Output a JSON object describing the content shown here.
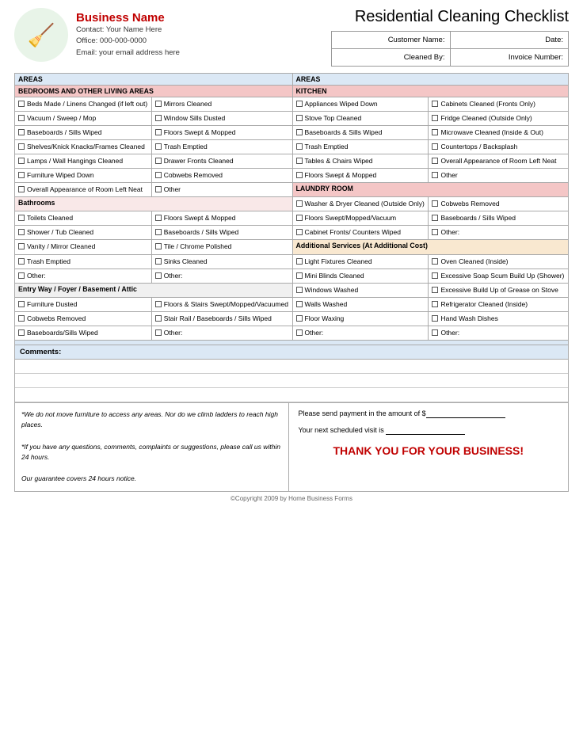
{
  "header": {
    "title": "Residential Cleaning Checklist",
    "business_name": "Business Name",
    "contact_label": "Contact:",
    "contact_value": "Your Name Here",
    "office_label": "Office:",
    "office_value": "000-000-0000",
    "email_label": "Email:",
    "email_value": "your email address here",
    "customer_name_label": "Customer Name:",
    "date_label": "Date:",
    "cleaned_by_label": "Cleaned By:",
    "invoice_label": "Invoice Number:"
  },
  "areas_label_left": "AREAS",
  "areas_label_right": "AREAS",
  "bedrooms_header": "BEDROOMS AND OTHER LIVING AREAS",
  "kitchen_header": "KITCHEN",
  "bedrooms_items_col1": [
    "Beds Made / Linens Changed (if left out)",
    "Vacuum / Sweep / Mop",
    "Baseboards / Sills Wiped",
    "Shelves/Knick Knacks/Frames Cleaned",
    "Lamps / Wall Hangings Cleaned",
    "Furniture Wiped Down",
    "Overall Appearance of Room Left Neat"
  ],
  "bedrooms_items_col2": [
    "Mirrors Cleaned",
    "Window Sills Dusted",
    "Floors Swept & Mopped",
    "Trash Emptied",
    "Drawer Fronts Cleaned",
    "Cobwebs Removed",
    "Other"
  ],
  "kitchen_items_col1": [
    "Appliances Wiped Down",
    "Stove Top Cleaned",
    "Baseboards & Sills Wiped",
    "Trash Emptied",
    "Tables & Chairs Wiped",
    "Floors Swept & Mopped"
  ],
  "kitchen_items_col2": [
    "Cabinets Cleaned (Fronts Only)",
    "Fridge Cleaned (Outside Only)",
    "Microwave Cleaned (Inside & Out)",
    "Countertops / Backsplash",
    "Overall Appearance of Room Left Neat",
    "Other"
  ],
  "bathrooms_header": "Bathrooms",
  "laundry_header": "LAUNDRY ROOM",
  "bathrooms_col1": [
    "Toilets Cleaned",
    "Shower / Tub Cleaned",
    "Vanity / Mirror Cleaned",
    "Trash Emptied",
    "Other:"
  ],
  "bathrooms_col2": [
    "Floors Swept & Mopped",
    "Baseboards / Sills Wiped",
    "Tile / Chrome Polished",
    "Sinks Cleaned",
    "Other:"
  ],
  "laundry_col1": [
    "Washer & Dryer Cleaned (Outside Only)",
    "Floors Swept/Mopped/Vacuum",
    "Cabinet Fronts/ Counters Wiped"
  ],
  "laundry_col2": [
    "Cobwebs Removed",
    "Baseboards / Sills Wiped",
    "Other:"
  ],
  "entry_header": "Entry Way / Foyer / Basement / Attic",
  "additional_header": "Additional Services (At Additional Cost)",
  "entry_col1": [
    "Furniture Dusted",
    "Cobwebs Removed",
    "Baseboards/Sills Wiped"
  ],
  "entry_col2": [
    "Floors & Stairs Swept/Mopped/Vacuumed",
    "Stair Rail / Baseboards / Sills Wiped",
    "Other:"
  ],
  "additional_col1": [
    "Light Fixtures Cleaned",
    "Mini Blinds Cleaned",
    "Windows Washed",
    "Walls Washed",
    "Floor Waxing",
    "Other:"
  ],
  "additional_col2": [
    "Oven Cleaned (Inside)",
    "Excessive Soap Scum Build Up (Shower)",
    "Excessive Build Up of Grease on Stove",
    "Refrigerator Cleaned (Inside)",
    "Hand Wash Dishes",
    "Other:"
  ],
  "comments_label": "Comments:",
  "footer_left": [
    "*We do not move furniture to access any areas.  Nor do we climb ladders to reach high places.",
    "*If you have any questions, comments, complaints or suggestions, please call us within 24 hours.",
    "Our guarantee covers 24 hours notice."
  ],
  "payment_text": "Please send payment in the amount of $",
  "scheduled_text": "Your next scheduled visit is",
  "thank_you": "THANK YOU FOR YOUR BUSINESS!",
  "copyright": "©Copyright 2009 by Home Business Forms"
}
